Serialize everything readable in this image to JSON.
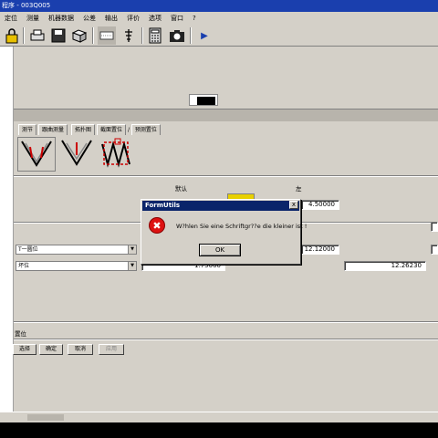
{
  "window": {
    "title": "程序 - 003Q005"
  },
  "menu": [
    "定位",
    "测量",
    "机器数据",
    "公差",
    "输出",
    "评价",
    "选项",
    "窗口",
    "?"
  ],
  "toolbar": {
    "icons": [
      "lock-icon",
      "print-icon",
      "save-icon",
      "box-icon",
      "gauge-icon",
      "probe-icon",
      "calculator-icon",
      "camera-icon",
      "play-icon"
    ]
  },
  "tabs": [
    "测节",
    "跟曲测量",
    "拓扑图",
    "截面置位",
    "/",
    "预测置位"
  ],
  "labels": {
    "default": "默认",
    "left": "左",
    "section": "置位"
  },
  "fields": {
    "left_value": "4.50000",
    "mid_value": "12.12000",
    "row2_value": "1.75000",
    "right_value": "12.26230"
  },
  "combos": {
    "combo1": "T一圆位",
    "combo2": "坏位"
  },
  "buttons": {
    "select": "选择",
    "confirm": "确定",
    "cancel": "取消",
    "apply": "应用"
  },
  "dialog": {
    "title": "FormUtils",
    "message": "W?hlen Sie eine Schriftgr??e die kleiner ist !",
    "ok": "OK",
    "close": "x"
  }
}
